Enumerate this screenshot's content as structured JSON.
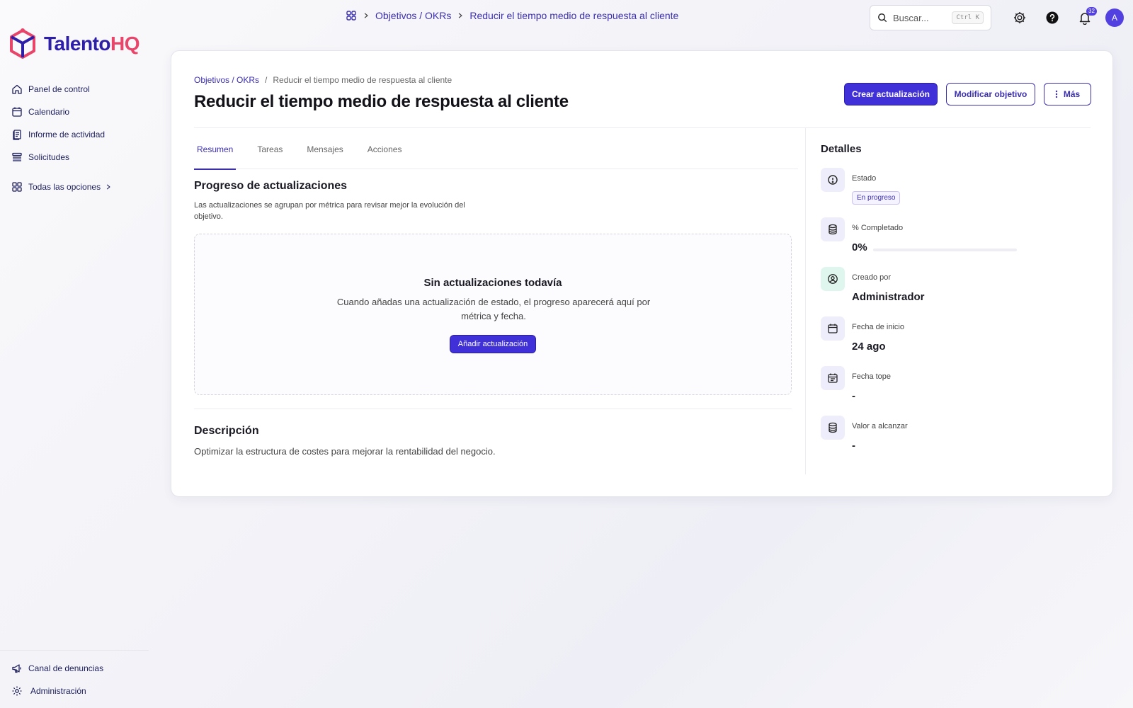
{
  "brand": {
    "name_part1": "Talento",
    "name_part2": "HQ"
  },
  "sidebar": {
    "items": [
      {
        "label": "Panel de control",
        "icon": "home-icon"
      },
      {
        "label": "Calendario",
        "icon": "calendar-icon"
      },
      {
        "label": "Informe de actividad",
        "icon": "report-icon"
      },
      {
        "label": "Solicitudes",
        "icon": "list-icon"
      }
    ],
    "all_options": "Todas las opciones",
    "bottom": [
      {
        "label": "Canal de denuncias",
        "icon": "megaphone-icon"
      },
      {
        "label": "Administración",
        "icon": "gear-icon"
      }
    ]
  },
  "topbar": {
    "breadcrumb": [
      "Objetivos / OKRs",
      "Reducir el tiempo medio de respuesta al cliente"
    ],
    "search_placeholder": "Buscar...",
    "search_shortcut": "Ctrl K",
    "notifications_count": "32",
    "avatar_initial": "A"
  },
  "page": {
    "breadcrumb_link": "Objetivos / OKRs",
    "breadcrumb_sep": "/",
    "breadcrumb_current": "Reducir el tiempo medio de respuesta al cliente",
    "title": "Reducir el tiempo medio de respuesta al cliente",
    "buttons": {
      "create_update": "Crear actualización",
      "modify": "Modificar objetivo",
      "more": "Más"
    },
    "tabs": [
      "Resumen",
      "Tareas",
      "Mensajes",
      "Acciones"
    ],
    "active_tab": "Resumen",
    "progress_section": {
      "title": "Progreso de actualizaciones",
      "description": "Las actualizaciones se agrupan por métrica para revisar mejor la evolución del objetivo.",
      "empty_title": "Sin actualizaciones todavía",
      "empty_description": "Cuando añadas una actualización de estado, el progreso aparecerá aquí por métrica y fecha.",
      "add_button": "Añadir actualización"
    },
    "description_section": {
      "title": "Descripción",
      "text": "Optimizar la estructura de costes para mejorar la rentabilidad del negocio."
    }
  },
  "details": {
    "title": "Detalles",
    "status_label": "Estado",
    "status_value": "En progreso",
    "completed_label": "% Completado",
    "completed_value": "0%",
    "completed_fraction": 0,
    "created_by_label": "Creado por",
    "created_by_value": "Administrador",
    "start_date_label": "Fecha de inicio",
    "start_date_value": "24 ago",
    "due_date_label": "Fecha tope",
    "due_date_value": "-",
    "target_label": "Valor a alcanzar",
    "target_value": "-"
  },
  "colors": {
    "accent": "#4030d8",
    "brand_blue": "#2d1fa8",
    "brand_pink": "#e8456a"
  }
}
